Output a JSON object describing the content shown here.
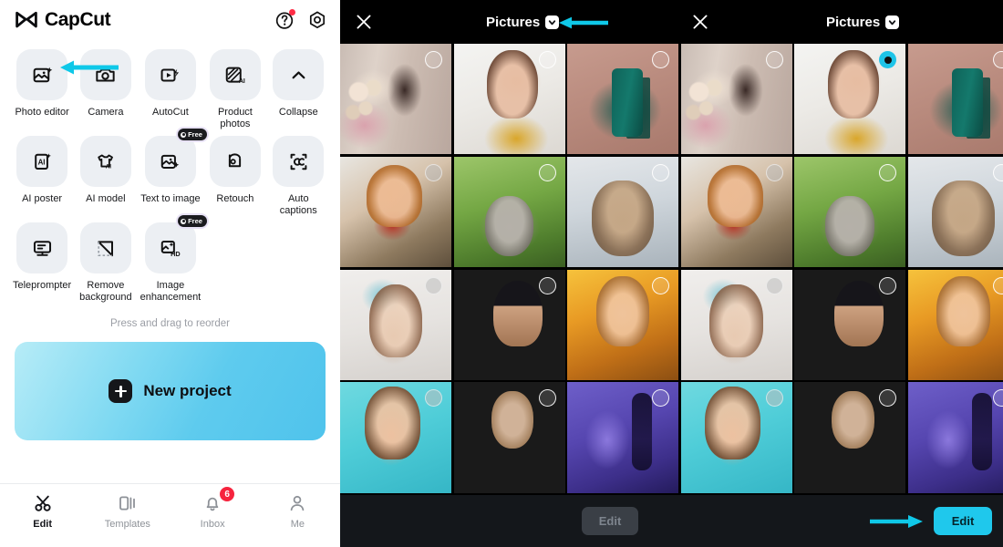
{
  "left_panel": {
    "brand": "CapCut",
    "header_icons": [
      {
        "name": "help-icon",
        "has_dot": true
      },
      {
        "name": "settings-gear-icon",
        "has_dot": false
      }
    ],
    "tools": [
      {
        "label": "Photo editor",
        "icon": "photo-editor-icon",
        "badge": null
      },
      {
        "label": "Camera",
        "icon": "camera-icon",
        "badge": null
      },
      {
        "label": "AutoCut",
        "icon": "autocut-icon",
        "badge": null
      },
      {
        "label": "Product photos",
        "icon": "product-photos-icon",
        "badge": null
      },
      {
        "label": "Collapse",
        "icon": "chevron-up-icon",
        "badge": null
      },
      {
        "label": "AI poster",
        "icon": "ai-poster-icon",
        "badge": null
      },
      {
        "label": "AI model",
        "icon": "ai-model-icon",
        "badge": null
      },
      {
        "label": "Text to image",
        "icon": "text-to-image-icon",
        "badge": "Free"
      },
      {
        "label": "Retouch",
        "icon": "retouch-icon",
        "badge": null
      },
      {
        "label": "Auto captions",
        "icon": "auto-captions-icon",
        "badge": null
      },
      {
        "label": "Teleprompter",
        "icon": "teleprompter-icon",
        "badge": null
      },
      {
        "label": "Remove background",
        "icon": "remove-background-icon",
        "badge": null
      },
      {
        "label": "Image enhancement",
        "icon": "image-enhancement-icon",
        "badge": "Free"
      }
    ],
    "reorder_hint": "Press and drag to reorder",
    "new_project_label": "New project",
    "tabs": [
      {
        "label": "Edit",
        "icon": "scissors-icon",
        "active": true,
        "badge": null
      },
      {
        "label": "Templates",
        "icon": "templates-icon",
        "active": false,
        "badge": null
      },
      {
        "label": "Inbox",
        "icon": "bell-icon",
        "active": false,
        "badge": "6"
      },
      {
        "label": "Me",
        "icon": "person-icon",
        "active": false,
        "badge": null
      }
    ]
  },
  "right_panel": {
    "panes": [
      {
        "close_icon": "close-icon",
        "title": "Pictures",
        "caret": "chevron-down-icon",
        "annotated": true
      },
      {
        "close_icon": "close-icon",
        "title": "Pictures",
        "caret": "chevron-down-icon",
        "annotated": false
      }
    ],
    "footer": {
      "edit_disabled_label": "Edit",
      "edit_primary_label": "Edit"
    },
    "grid": {
      "columns": 6,
      "rows": 4,
      "cells": [
        {
          "art": "ph-flowers",
          "selected": false,
          "dim": false
        },
        {
          "art": "ph-smile",
          "selected": false,
          "dim": false
        },
        {
          "art": "ph-mug",
          "selected": false,
          "dim": false
        },
        {
          "art": "ph-flowers",
          "selected": false,
          "dim": false
        },
        {
          "art": "ph-smile",
          "selected": true,
          "dim": false
        },
        {
          "art": "ph-mug",
          "selected": false,
          "dim": false
        },
        {
          "art": "ph-red",
          "selected": false,
          "dim": true
        },
        {
          "art": "ph-kitten1",
          "selected": false,
          "dim": false
        },
        {
          "art": "ph-kitten2",
          "selected": false,
          "dim": false
        },
        {
          "art": "ph-red",
          "selected": false,
          "dim": true
        },
        {
          "art": "ph-kitten1",
          "selected": false,
          "dim": false
        },
        {
          "art": "ph-kitten2",
          "selected": false,
          "dim": false
        },
        {
          "art": "ph-flower-hair",
          "selected": false,
          "dim": true
        },
        {
          "art": "ph-beanie",
          "selected": false,
          "dim": false
        },
        {
          "art": "ph-golden",
          "selected": false,
          "dim": false
        },
        {
          "art": "ph-flower-hair",
          "selected": false,
          "dim": true
        },
        {
          "art": "ph-beanie",
          "selected": false,
          "dim": false
        },
        {
          "art": "ph-golden",
          "selected": false,
          "dim": false
        },
        {
          "art": "ph-teal",
          "selected": false,
          "dim": true
        },
        {
          "art": "ph-pinkflowers",
          "selected": false,
          "dim": false
        },
        {
          "art": "ph-purple",
          "selected": false,
          "dim": false
        },
        {
          "art": "ph-teal",
          "selected": false,
          "dim": true
        },
        {
          "art": "ph-pinkflowers",
          "selected": false,
          "dim": false
        },
        {
          "art": "ph-purple",
          "selected": false,
          "dim": false
        }
      ]
    }
  },
  "colors": {
    "accent_cyan": "#1fc8ec",
    "badge_red": "#f6243e",
    "panel_dark": "#000000",
    "footer_dark": "#14171b",
    "tool_tile": "#eceff3"
  }
}
